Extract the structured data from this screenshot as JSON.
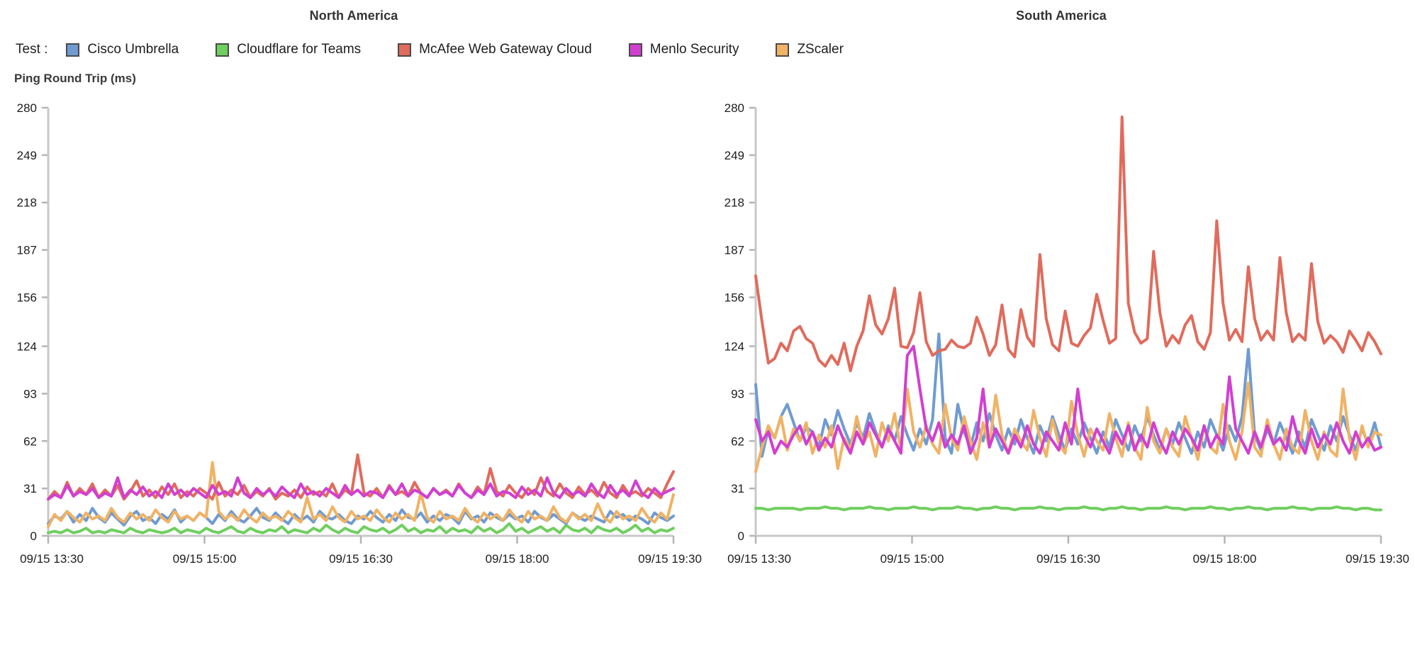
{
  "panels": [
    {
      "id": "north-america",
      "title": "North America"
    },
    {
      "id": "south-america",
      "title": "South America"
    }
  ],
  "legend": {
    "label": "Test :",
    "items": [
      {
        "name": "Cisco Umbrella",
        "color": "#6f9bd1",
        "swatch_icon": "legend-color-swatch"
      },
      {
        "name": "Cloudflare for Teams",
        "color": "#6fcf5f",
        "swatch_icon": "legend-color-swatch"
      },
      {
        "name": "McAfee Web Gateway Cloud",
        "color": "#e06b5c",
        "swatch_icon": "legend-color-swatch"
      },
      {
        "name": "Menlo Security",
        "color": "#d13fd1",
        "swatch_icon": "legend-color-swatch"
      },
      {
        "name": "ZScaler",
        "color": "#f0b264",
        "swatch_icon": "legend-color-swatch"
      }
    ]
  },
  "y_caption": "Ping Round Trip (ms)",
  "chart_data": [
    {
      "type": "line",
      "title": "North America",
      "xlabel": "",
      "ylabel": "Ping Round Trip (ms)",
      "ylim": [
        0,
        280
      ],
      "ytick_labels": [
        "280",
        "249",
        "218",
        "187",
        "156",
        "124",
        "93",
        "62",
        "31",
        "0"
      ],
      "ytick_values": [
        280,
        249,
        218,
        187,
        156,
        124,
        93,
        62,
        31,
        0
      ],
      "xtick_labels": [
        "09/15 13:30",
        "09/15 15:00",
        "09/15 16:30",
        "09/15 18:00",
        "09/15 19:30"
      ],
      "grid": false,
      "legend_position": "top",
      "series": [
        {
          "name": "Cisco Umbrella",
          "color": "#6f9bd1",
          "values": [
            8,
            13,
            11,
            16,
            9,
            14,
            10,
            18,
            12,
            9,
            15,
            11,
            7,
            13,
            16,
            10,
            12,
            8,
            14,
            11,
            17,
            9,
            13,
            10,
            15,
            12,
            8,
            14,
            10,
            16,
            11,
            9,
            13,
            18,
            12,
            10,
            15,
            11,
            8,
            14,
            10,
            13,
            9,
            16,
            12,
            11,
            14,
            10,
            8,
            13,
            11,
            16,
            12,
            9,
            14,
            10,
            17,
            12,
            11,
            15,
            9,
            13,
            10,
            14,
            12,
            8,
            16,
            11,
            13,
            9,
            15,
            12,
            10,
            14,
            11,
            13,
            9,
            16,
            12,
            10,
            14,
            11,
            8,
            15,
            12,
            10,
            13,
            11,
            9,
            16,
            12,
            14,
            10,
            13,
            11,
            8,
            15,
            12,
            10,
            13
          ]
        },
        {
          "name": "Cloudflare for Teams",
          "color": "#6fcf5f",
          "values": [
            2,
            3,
            2,
            4,
            2,
            3,
            5,
            2,
            3,
            2,
            4,
            3,
            2,
            5,
            3,
            2,
            4,
            3,
            2,
            3,
            5,
            2,
            4,
            3,
            2,
            5,
            3,
            2,
            4,
            6,
            3,
            2,
            5,
            3,
            2,
            4,
            3,
            6,
            2,
            4,
            3,
            2,
            5,
            3,
            7,
            4,
            2,
            5,
            3,
            2,
            6,
            4,
            3,
            5,
            2,
            4,
            7,
            3,
            5,
            2,
            4,
            3,
            6,
            2,
            5,
            3,
            4,
            2,
            6,
            3,
            5,
            2,
            4,
            8,
            3,
            5,
            2,
            4,
            6,
            3,
            5,
            2,
            7,
            4,
            3,
            5,
            2,
            6,
            4,
            3,
            5,
            2,
            4,
            7,
            3,
            5,
            2,
            4,
            3,
            5
          ]
        },
        {
          "name": "McAfee Web Gateway Cloud",
          "color": "#e06b5c",
          "values": [
            24,
            29,
            25,
            35,
            26,
            31,
            27,
            34,
            25,
            30,
            26,
            33,
            24,
            29,
            36,
            26,
            30,
            25,
            32,
            27,
            34,
            25,
            29,
            26,
            31,
            28,
            24,
            35,
            26,
            30,
            27,
            33,
            25,
            29,
            26,
            31,
            24,
            28,
            26,
            30,
            25,
            32,
            27,
            29,
            26,
            34,
            25,
            30,
            27,
            53,
            28,
            26,
            31,
            25,
            33,
            27,
            29,
            26,
            35,
            28,
            25,
            31,
            27,
            30,
            26,
            34,
            28,
            25,
            32,
            27,
            44,
            29,
            26,
            33,
            28,
            25,
            31,
            27,
            38,
            29,
            26,
            34,
            28,
            25,
            32,
            27,
            30,
            26,
            35,
            28,
            25,
            33,
            27,
            29,
            26,
            31,
            28,
            25,
            34,
            42
          ]
        },
        {
          "name": "Menlo Security",
          "color": "#d13fd1",
          "values": [
            24,
            27,
            25,
            33,
            26,
            29,
            27,
            31,
            25,
            28,
            26,
            38,
            25,
            30,
            27,
            32,
            26,
            29,
            25,
            34,
            27,
            30,
            26,
            31,
            28,
            25,
            33,
            27,
            29,
            26,
            38,
            28,
            25,
            31,
            27,
            30,
            26,
            32,
            28,
            25,
            34,
            27,
            29,
            26,
            31,
            28,
            25,
            33,
            27,
            30,
            26,
            29,
            28,
            25,
            32,
            27,
            34,
            26,
            30,
            28,
            25,
            31,
            27,
            29,
            26,
            33,
            28,
            25,
            30,
            27,
            34,
            26,
            29,
            28,
            25,
            32,
            27,
            30,
            26,
            38,
            28,
            25,
            31,
            27,
            29,
            26,
            34,
            28,
            25,
            33,
            27,
            30,
            26,
            36,
            28,
            25,
            31,
            27,
            29,
            31
          ]
        },
        {
          "name": "ZScaler",
          "color": "#f0b264",
          "values": [
            6,
            14,
            10,
            16,
            12,
            9,
            15,
            11,
            13,
            10,
            18,
            12,
            9,
            15,
            11,
            14,
            10,
            17,
            12,
            9,
            16,
            11,
            13,
            10,
            15,
            12,
            48,
            16,
            11,
            14,
            10,
            17,
            12,
            9,
            15,
            11,
            13,
            10,
            16,
            12,
            9,
            25,
            11,
            14,
            10,
            19,
            12,
            9,
            16,
            11,
            13,
            10,
            17,
            12,
            9,
            15,
            11,
            14,
            10,
            28,
            12,
            9,
            16,
            11,
            13,
            10,
            18,
            12,
            9,
            15,
            11,
            14,
            10,
            17,
            12,
            9,
            16,
            11,
            13,
            10,
            19,
            12,
            9,
            15,
            11,
            14,
            10,
            21,
            12,
            9,
            16,
            11,
            13,
            10,
            18,
            12,
            9,
            15,
            11,
            27
          ]
        }
      ]
    },
    {
      "type": "line",
      "title": "South America",
      "xlabel": "",
      "ylabel": "Ping Round Trip (ms)",
      "ylim": [
        0,
        280
      ],
      "ytick_labels": [
        "280",
        "249",
        "218",
        "187",
        "156",
        "124",
        "93",
        "62",
        "31",
        "0"
      ],
      "ytick_values": [
        280,
        249,
        218,
        187,
        156,
        124,
        93,
        62,
        31,
        0
      ],
      "xtick_labels": [
        "09/15 13:30",
        "09/15 15:00",
        "09/15 16:30",
        "09/15 18:00",
        "09/15 19:30"
      ],
      "grid": false,
      "legend_position": "top",
      "series": [
        {
          "name": "Cisco Umbrella",
          "color": "#6f9bd1",
          "values": [
            99,
            52,
            70,
            64,
            78,
            86,
            74,
            62,
            71,
            68,
            58,
            76,
            66,
            82,
            70,
            60,
            74,
            64,
            80,
            68,
            58,
            72,
            62,
            78,
            66,
            56,
            70,
            60,
            76,
            132,
            64,
            54,
            86,
            68,
            58,
            74,
            62,
            80,
            66,
            56,
            70,
            60,
            76,
            64,
            54,
            72,
            62,
            78,
            66,
            56,
            70,
            60,
            74,
            64,
            54,
            68,
            58,
            76,
            66,
            56,
            72,
            62,
            78,
            66,
            56,
            70,
            60,
            74,
            64,
            54,
            68,
            58,
            76,
            66,
            56,
            72,
            62,
            78,
            122,
            66,
            56,
            70,
            60,
            74,
            64,
            54,
            68,
            58,
            76,
            66,
            56,
            72,
            62,
            78,
            66,
            56,
            70,
            60,
            74,
            58
          ]
        },
        {
          "name": "Cloudflare for Teams",
          "color": "#6fcf5f",
          "values": [
            18,
            18,
            17,
            18,
            18,
            18,
            18,
            17,
            18,
            18,
            18,
            19,
            18,
            18,
            17,
            18,
            18,
            18,
            19,
            18,
            18,
            17,
            18,
            18,
            18,
            19,
            18,
            18,
            17,
            18,
            18,
            18,
            19,
            18,
            18,
            17,
            18,
            18,
            19,
            18,
            18,
            17,
            18,
            18,
            18,
            19,
            18,
            18,
            17,
            18,
            18,
            18,
            19,
            18,
            18,
            17,
            18,
            18,
            19,
            18,
            18,
            17,
            18,
            18,
            18,
            19,
            18,
            18,
            17,
            18,
            18,
            18,
            19,
            18,
            18,
            17,
            18,
            18,
            19,
            18,
            18,
            17,
            18,
            18,
            18,
            19,
            18,
            18,
            17,
            18,
            18,
            18,
            19,
            18,
            18,
            17,
            18,
            18,
            17,
            17
          ]
        },
        {
          "name": "McAfee Web Gateway Cloud",
          "color": "#e06b5c",
          "values": [
            170,
            140,
            113,
            116,
            126,
            121,
            134,
            137,
            129,
            126,
            115,
            111,
            118,
            112,
            126,
            108,
            124,
            134,
            157,
            138,
            132,
            142,
            162,
            124,
            123,
            133,
            159,
            127,
            118,
            121,
            122,
            128,
            124,
            123,
            126,
            143,
            132,
            118,
            125,
            151,
            122,
            117,
            148,
            130,
            124,
            184,
            142,
            125,
            121,
            147,
            126,
            124,
            131,
            136,
            158,
            141,
            126,
            129,
            274,
            152,
            133,
            126,
            129,
            186,
            146,
            124,
            131,
            126,
            138,
            144,
            127,
            122,
            133,
            206,
            152,
            128,
            135,
            127,
            176,
            142,
            128,
            134,
            128,
            182,
            146,
            127,
            132,
            128,
            178,
            140,
            126,
            131,
            127,
            120,
            134,
            128,
            121,
            133,
            127,
            119
          ]
        },
        {
          "name": "Menlo Security",
          "color": "#d13fd1",
          "values": [
            76,
            62,
            68,
            54,
            62,
            58,
            66,
            72,
            60,
            68,
            56,
            64,
            58,
            72,
            62,
            54,
            68,
            60,
            74,
            66,
            58,
            70,
            62,
            54,
            118,
            124,
            96,
            70,
            62,
            74,
            58,
            66,
            60,
            72,
            54,
            64,
            96,
            58,
            70,
            62,
            54,
            66,
            58,
            72,
            60,
            54,
            68,
            62,
            56,
            74,
            60,
            96,
            66,
            58,
            70,
            62,
            54,
            68,
            60,
            72,
            56,
            66,
            58,
            74,
            62,
            54,
            68,
            60,
            70,
            64,
            56,
            72,
            58,
            66,
            60,
            104,
            70,
            62,
            54,
            68,
            58,
            72,
            60,
            64,
            56,
            78,
            62,
            54,
            70,
            58,
            66,
            60,
            74,
            62,
            54,
            68,
            58,
            64,
            56,
            58
          ]
        },
        {
          "name": "ZScaler",
          "color": "#f0b264",
          "values": [
            42,
            58,
            72,
            64,
            78,
            56,
            70,
            62,
            74,
            54,
            66,
            58,
            72,
            44,
            64,
            56,
            78,
            60,
            68,
            52,
            74,
            62,
            80,
            56,
            96,
            68,
            58,
            72,
            60,
            54,
            86,
            64,
            56,
            78,
            62,
            50,
            74,
            58,
            92,
            66,
            54,
            70,
            62,
            56,
            82,
            64,
            52,
            76,
            60,
            54,
            88,
            66,
            52,
            70,
            62,
            56,
            80,
            64,
            52,
            74,
            58,
            50,
            84,
            62,
            54,
            70,
            58,
            52,
            78,
            64,
            50,
            72,
            58,
            54,
            86,
            62,
            50,
            68,
            100,
            58,
            52,
            76,
            60,
            50,
            70,
            58,
            54,
            82,
            62,
            50,
            68,
            56,
            52,
            96,
            64,
            50,
            72,
            58,
            68,
            66
          ]
        }
      ]
    }
  ]
}
